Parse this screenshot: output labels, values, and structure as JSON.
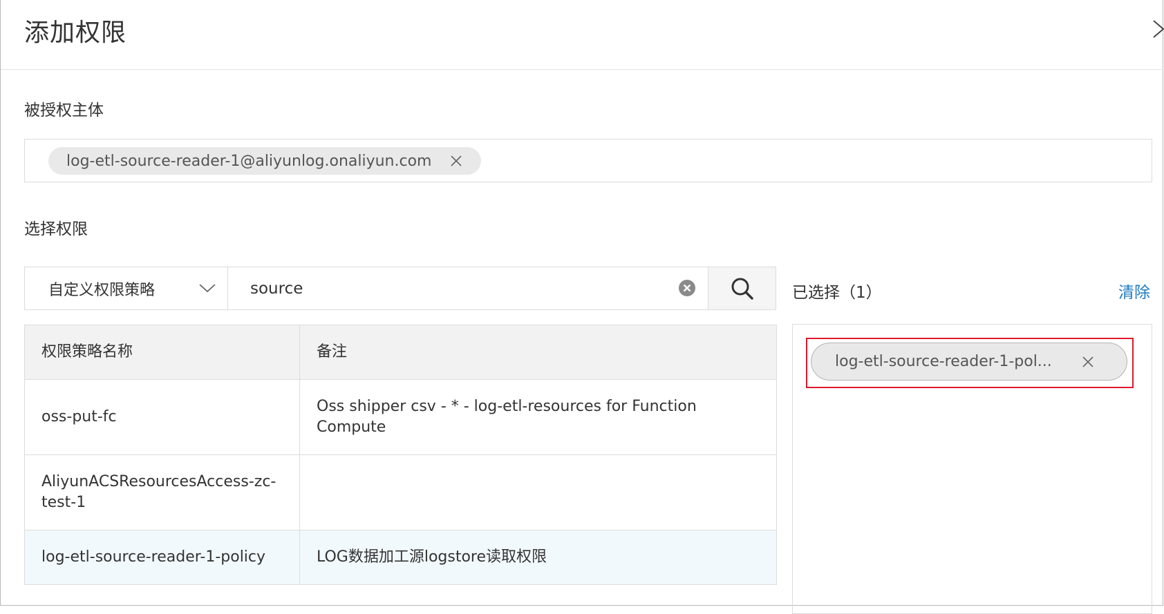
{
  "dialog": {
    "title": "添加权限"
  },
  "principal": {
    "label": "被授权主体",
    "tag": "log-etl-source-reader-1@aliyunlog.onaliyun.com"
  },
  "permissions": {
    "label": "选择权限",
    "type_select": "自定义权限策略",
    "search_value": "source"
  },
  "table": {
    "headers": [
      "权限策略名称",
      "备注"
    ],
    "rows": [
      {
        "name": "oss-put-fc",
        "note": "Oss shipper csv - * - log-etl-resources for Function Compute"
      },
      {
        "name": "AliyunACSResourcesAccess-zc-test-1",
        "note": ""
      },
      {
        "name": "log-etl-source-reader-1-policy",
        "note": "LOG数据加工源logstore读取权限"
      }
    ]
  },
  "selected": {
    "title": "已选择（1）",
    "clear_label": "清除",
    "items": [
      "log-etl-source-reader-1-pol..."
    ]
  },
  "colors": {
    "link": "#1f7bbf",
    "highlight": "#e0182a",
    "selected_row": "#f2f9fd",
    "header_bg": "#f2f2f2"
  },
  "icons": [
    "close-icon",
    "chevron-down-icon",
    "clear-circle-icon",
    "search-icon"
  ]
}
